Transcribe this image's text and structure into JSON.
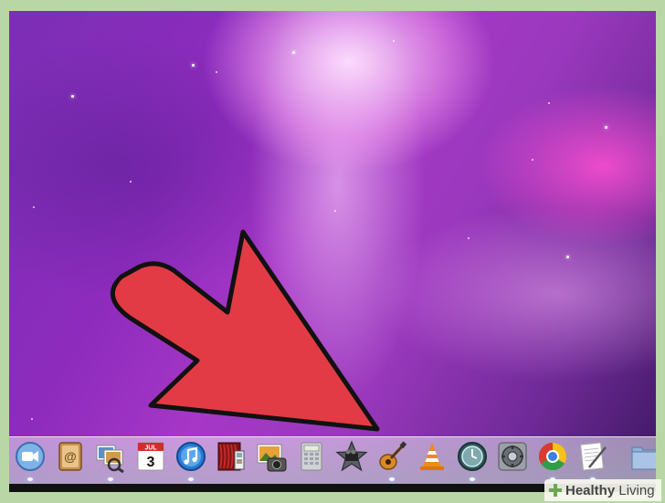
{
  "desktop": {
    "wallpaper": "aurora-galaxy",
    "accent_colors": {
      "purple": "#8d2bbd",
      "pink": "#ff50d2",
      "arrow_red": "#e23b45"
    }
  },
  "callout_arrow": {
    "color": "#e23b45",
    "outline": "#111111",
    "points_to": "dock-item-garageband"
  },
  "calendar": {
    "month": "JUL",
    "day": "3"
  },
  "dock": {
    "items": [
      {
        "name": "facetime",
        "icon": "facetime-icon"
      },
      {
        "name": "address-book",
        "icon": "address-book-icon"
      },
      {
        "name": "preview",
        "icon": "preview-icon"
      },
      {
        "name": "ical",
        "icon": "calendar-icon"
      },
      {
        "name": "itunes",
        "icon": "itunes-icon"
      },
      {
        "name": "photo-booth",
        "icon": "photo-booth-icon"
      },
      {
        "name": "iphoto",
        "icon": "iphoto-icon"
      },
      {
        "name": "calculator",
        "icon": "calculator-icon"
      },
      {
        "name": "imovie",
        "icon": "imovie-icon"
      },
      {
        "name": "garageband",
        "icon": "garageband-icon"
      },
      {
        "name": "vlc",
        "icon": "vlc-icon"
      },
      {
        "name": "time-machine",
        "icon": "time-machine-icon"
      },
      {
        "name": "system-preferences",
        "icon": "system-preferences-icon"
      },
      {
        "name": "chrome",
        "icon": "chrome-icon"
      },
      {
        "name": "textedit",
        "icon": "textedit-icon"
      },
      {
        "name": "applications-folder",
        "icon": "folder-icon"
      }
    ]
  },
  "watermark": {
    "brand_bold": "Healthy",
    "brand_thin": " Living"
  }
}
